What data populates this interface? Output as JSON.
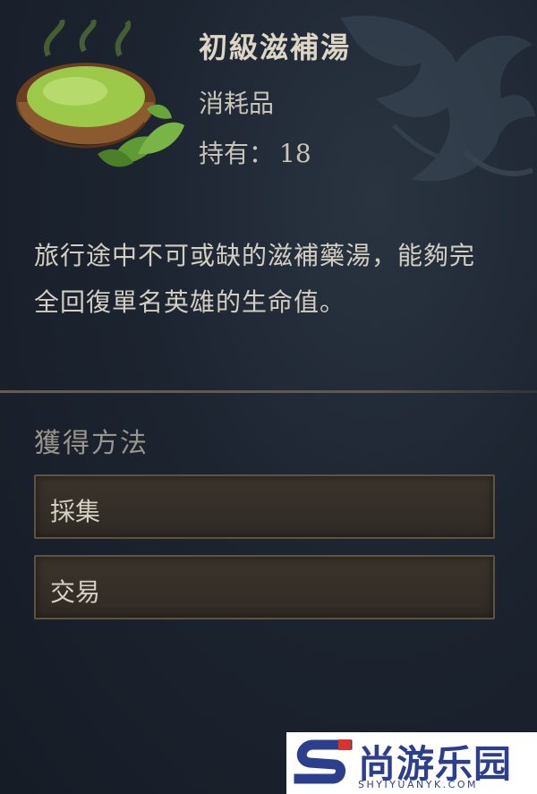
{
  "item": {
    "name": "初級滋補湯",
    "type": "消耗品",
    "owned_label": "持有：",
    "owned_count": "18",
    "icon": "herbal-soup-bowl-icon",
    "description": "旅行途中不可或缺的滋補藥湯，能夠完全回復單名英雄的生命值。"
  },
  "acquisition": {
    "title": "獲得方法",
    "sources": [
      {
        "label": "採集"
      },
      {
        "label": "交易"
      }
    ]
  },
  "watermark": {
    "brand": "尚游乐园",
    "url": "SHYIYUANYK.COM",
    "icon": "s-logo-icon"
  },
  "colors": {
    "background": "#1c2430",
    "soup": "#9cc94a",
    "bowl": "#7a4a26",
    "button_border": "#5e5444",
    "watermark_blue": "#2b3f8c",
    "watermark_red": "#d9342b"
  }
}
